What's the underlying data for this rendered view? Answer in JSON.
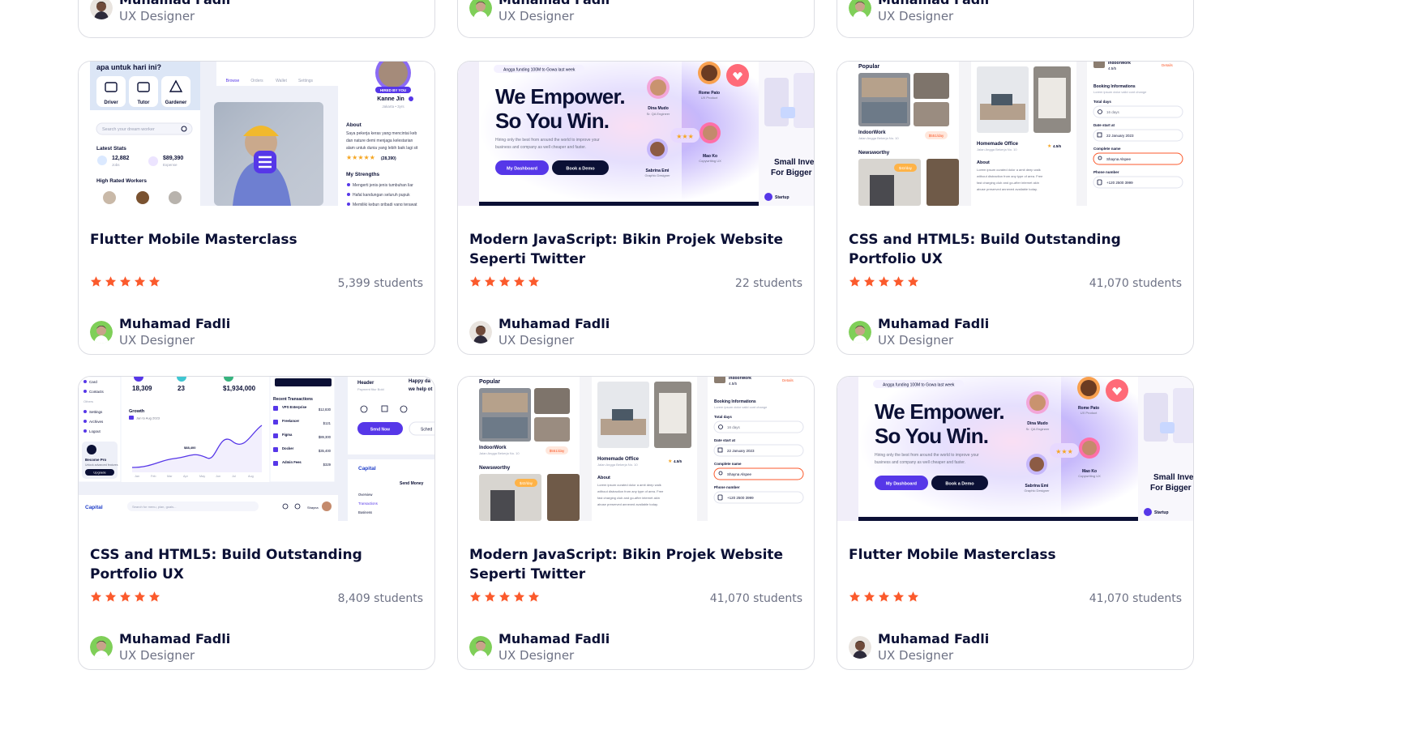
{
  "colors": {
    "star": "#fb5a2c",
    "accent": "#5637e8",
    "dark": "#0b1035"
  },
  "author": {
    "name": "Muhamad Fadli",
    "role": "UX Designer"
  },
  "partial_cards": [
    {
      "avatar": "avatar-orange"
    },
    {
      "avatar": "avatar-green"
    },
    {
      "avatar": "avatar-green"
    }
  ],
  "courses": [
    {
      "title": "Flutter Mobile Masterclass",
      "students": "5,399 students",
      "rating": 5,
      "avatar": "avatar-green",
      "thumbnail_type": "jobs-app",
      "thumb": {
        "greeting": "apa untuk hari ini?",
        "categories": [
          "Driver",
          "Tutor",
          "Gardener"
        ],
        "search_placeholder": "Search your dream worker",
        "latest_stats": "Latest Stats",
        "stat1_value": "12,882",
        "stat1_label": "Jobs",
        "stat2_value": "$89,390",
        "stat2_label": "Expense",
        "high_rated": "High Rated Workers",
        "nav": [
          "Browse",
          "Orders",
          "Wallet",
          "Settings"
        ],
        "hired": "HIRED BY YOU",
        "profile_name": "Kanne Jin",
        "profile_location": "Jakarta • 3yrs",
        "reviews": "(28,390)",
        "about": "About",
        "about_text": [
          "Saya pekerja keras yang mencintai keb",
          "dan nature demi menjaga kelestarian",
          "alam untuk dunia yang lebih baik lagi sit"
        ],
        "strengths": "My Strengths",
        "strengths_list": [
          "Mengerti jenis-jenis tumbuhan liar",
          "Hafal kandungan seluruh pupuk",
          "Memiliki kebun pribadi yang terawat"
        ]
      }
    },
    {
      "title": "Modern JavaScript: Bikin Projek Website Seperti Twitter",
      "students": "22 students",
      "rating": 5,
      "avatar": "avatar-orange",
      "thumbnail_type": "empower",
      "thumb": {
        "badge": "Angga funding 100M to Gowa last week",
        "headline1": "We Empower.",
        "headline2": "So You Win.",
        "sub1": "Hiring only the best from around the world to improve your",
        "sub2": "business and company as well cheaper and faster.",
        "btn1": "My Dashboard",
        "btn2": "Book a Demo",
        "p1_name": "Dina Mudo",
        "p1_role": "Sr. QA Engineer",
        "p2_name": "Rome Pato",
        "p2_role": "UX Product",
        "p3_name": "Mao Ko",
        "p3_role": "Copywriting UX",
        "p4_name": "Sabrina Emi",
        "p4_role": "Graphic Designer",
        "side_text1": "Small Inves",
        "side_text2": "For Bigger Ir",
        "side_label": "Startup"
      }
    },
    {
      "title": "CSS and HTML5: Build Outstanding Portfolio UX",
      "students": "41,070 students",
      "rating": 5,
      "avatar": "avatar-green",
      "thumbnail_type": "office",
      "thumb": {
        "popular": "Popular",
        "place1": "IndoorWork",
        "place1_addr": "Jalan Angga Bekerja No. 10",
        "price1": "$551/day",
        "newsworthy": "Newsworthy",
        "price2": "$42/day",
        "place2": "Homemade Office",
        "place2_addr": "Jalan Angga Bekerja No. 10",
        "rating2": "4.5/5",
        "about": "About",
        "about_text": [
          "Lorem ipsum curated dolor a amit deep walk",
          "without distraction from any type of area. Free",
          "fast charging club and go-after internet akin",
          "abuse preserved annexed available today."
        ],
        "top_item": "IndoorWork",
        "top_rating": "4.5/5",
        "details": "Details",
        "booking": "Booking Informations",
        "booking_sub": "Lorem ipsum dolor valid cont change",
        "total_days": "Total days",
        "days_val": "16 days",
        "date_label": "Date start at",
        "date_val": "22 January 2023",
        "name_label": "Complete name",
        "name_val": "Shayna Alspee",
        "phone_label": "Phone number",
        "phone_val": "+120 2500 3999"
      }
    },
    {
      "title": "CSS and HTML5: Build Outstanding Portfolio UX",
      "students": "8,409 students",
      "rating": 5,
      "avatar": "avatar-green",
      "thumbnail_type": "dashboard",
      "thumb": {
        "sidebar": [
          "Card",
          "Contacts",
          "Others",
          "Settings",
          "Archives",
          "Logout"
        ],
        "pro_title": "Become Pro",
        "pro_sub": "Unlock advanced features",
        "upgrade": "Upgrade",
        "stat1": "18,309",
        "stat2": "23",
        "stat3": "$1,934,000",
        "growth": "Growth",
        "growth_date": "Jan to Aug 2023",
        "peak": "$88,400",
        "months": [
          "Jan",
          "Feb",
          "Mar",
          "Apr",
          "May",
          "Jun",
          "Jul",
          "Aug"
        ],
        "tx_title": "Recent Transactions",
        "tx": [
          {
            "name": "VPS Enterprise",
            "amount": "$12,830"
          },
          {
            "name": "Freelancer",
            "amount": "$121"
          },
          {
            "name": "Figma",
            "amount": "$89,300"
          },
          {
            "name": "Docker",
            "amount": "$35,400"
          },
          {
            "name": "Admin Fees",
            "amount": "$329"
          }
        ],
        "header": "Header",
        "header_sub": "Payment fitur Bold",
        "happy": "Happy da",
        "help": "we help ot",
        "send_now": "Send Now",
        "sched": "Sched",
        "logo": "Capital",
        "search": "Search for menu, plan, goals...",
        "user_name": "Shayna",
        "send_money": "Send Money",
        "transactions": "Transactions",
        "overview": "Overview",
        "business": "Business"
      }
    },
    {
      "title": "Modern JavaScript: Bikin Projek Website Seperti Twitter",
      "students": "41,070 students",
      "rating": 5,
      "avatar": "avatar-green",
      "thumbnail_type": "office",
      "thumb": {
        "popular": "Popular",
        "place1": "IndoorWork",
        "place1_addr": "Jalan Angga Bekerja No. 10",
        "price1": "$551/day",
        "newsworthy": "Newsworthy",
        "price2": "$42/day",
        "place2": "Homemade Office",
        "place2_addr": "Jalan Angga Bekerja No. 10",
        "rating2": "4.5/5",
        "about": "About",
        "about_text": [
          "Lorem ipsum curated dolor a amit deep walk",
          "without distraction from any type of area. Free",
          "fast charging club and go-after internet akin",
          "abuse preserved annexed available today."
        ],
        "top_item": "IndoorWork",
        "top_rating": "4.5/5",
        "details": "Details",
        "booking": "Booking Informations",
        "booking_sub": "Lorem ipsum dolor valid cont change",
        "total_days": "Total days",
        "days_val": "16 days",
        "date_label": "Date start at",
        "date_val": "22 January 2023",
        "name_label": "Complete name",
        "name_val": "Shayna Alspee",
        "phone_label": "Phone number",
        "phone_val": "+120 2500 3999"
      }
    },
    {
      "title": "Flutter Mobile Masterclass",
      "students": "41,070 students",
      "rating": 5,
      "avatar": "avatar-orange",
      "thumbnail_type": "empower",
      "thumb": {
        "badge": "Angga funding 100M to Gowa last week",
        "headline1": "We Empower.",
        "headline2": "So You Win.",
        "sub1": "Hiring only the best from around the world to improve your",
        "sub2": "business and company as well cheaper and faster.",
        "btn1": "My Dashboard",
        "btn2": "Book a Demo",
        "p1_name": "Dina Mudo",
        "p1_role": "Sr. QA Engineer",
        "p2_name": "Rome Pato",
        "p2_role": "UX Product",
        "p3_name": "Mao Ko",
        "p3_role": "Copywriting UX",
        "p4_name": "Sabrina Emi",
        "p4_role": "Graphic Designer",
        "side_text1": "Small Inves",
        "side_text2": "For Bigger Ir",
        "side_label": "Startup"
      }
    }
  ]
}
